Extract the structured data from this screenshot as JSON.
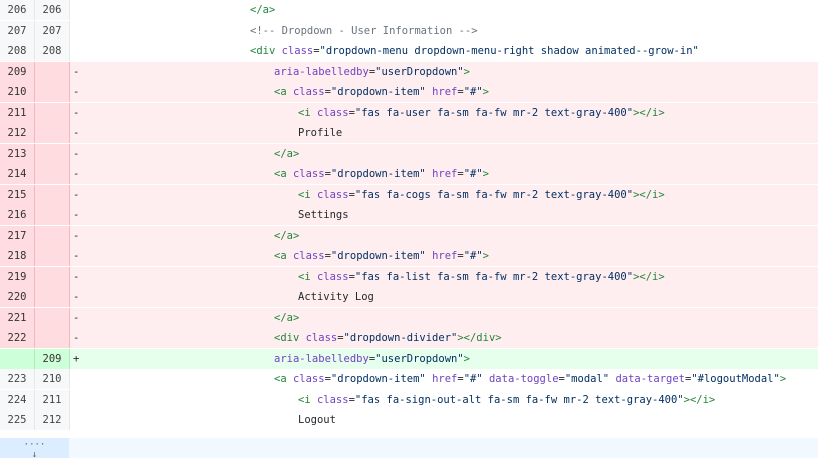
{
  "rows": [
    {
      "type": "ctx",
      "old": "206",
      "new": "206",
      "marker": "",
      "indent": 7,
      "tokens": [
        [
          "tag",
          "</a>"
        ]
      ]
    },
    {
      "type": "ctx",
      "old": "207",
      "new": "207",
      "marker": "",
      "indent": 7,
      "tokens": [
        [
          "cmt",
          "<!-- Dropdown - User Information -->"
        ]
      ]
    },
    {
      "type": "ctx",
      "old": "208",
      "new": "208",
      "marker": "",
      "indent": 7,
      "tokens": [
        [
          "tag",
          "<div "
        ],
        [
          "attr",
          "class"
        ],
        [
          "punc",
          "="
        ],
        [
          "str",
          "\"dropdown-menu dropdown-menu-right shadow animated--grow-in\""
        ]
      ]
    },
    {
      "type": "del",
      "old": "209",
      "new": "",
      "marker": "-",
      "indent": 8,
      "tokens": [
        [
          "attr",
          "aria-labelledby"
        ],
        [
          "punc",
          "="
        ],
        [
          "str",
          "\"userDropdown\""
        ],
        [
          "tag",
          ">"
        ]
      ]
    },
    {
      "type": "del",
      "old": "210",
      "new": "",
      "marker": "-",
      "indent": 8,
      "tokens": [
        [
          "tag",
          "<a "
        ],
        [
          "attr",
          "class"
        ],
        [
          "punc",
          "="
        ],
        [
          "str",
          "\"dropdown-item\""
        ],
        [
          "punc",
          " "
        ],
        [
          "attr",
          "href"
        ],
        [
          "punc",
          "="
        ],
        [
          "str",
          "\"#\""
        ],
        [
          "tag",
          ">"
        ]
      ]
    },
    {
      "type": "del",
      "old": "211",
      "new": "",
      "marker": "-",
      "indent": 9,
      "tokens": [
        [
          "tag",
          "<i "
        ],
        [
          "attr",
          "class"
        ],
        [
          "punc",
          "="
        ],
        [
          "str",
          "\"fas fa-user fa-sm fa-fw mr-2 text-gray-400\""
        ],
        [
          "tag",
          "></i>"
        ]
      ]
    },
    {
      "type": "del",
      "old": "212",
      "new": "",
      "marker": "-",
      "indent": 9,
      "tokens": [
        [
          "txt",
          "Profile"
        ]
      ]
    },
    {
      "type": "del",
      "old": "213",
      "new": "",
      "marker": "-",
      "indent": 8,
      "tokens": [
        [
          "tag",
          "</a>"
        ]
      ]
    },
    {
      "type": "del",
      "old": "214",
      "new": "",
      "marker": "-",
      "indent": 8,
      "tokens": [
        [
          "tag",
          "<a "
        ],
        [
          "attr",
          "class"
        ],
        [
          "punc",
          "="
        ],
        [
          "str",
          "\"dropdown-item\""
        ],
        [
          "punc",
          " "
        ],
        [
          "attr",
          "href"
        ],
        [
          "punc",
          "="
        ],
        [
          "str",
          "\"#\""
        ],
        [
          "tag",
          ">"
        ]
      ]
    },
    {
      "type": "del",
      "old": "215",
      "new": "",
      "marker": "-",
      "indent": 9,
      "tokens": [
        [
          "tag",
          "<i "
        ],
        [
          "attr",
          "class"
        ],
        [
          "punc",
          "="
        ],
        [
          "str",
          "\"fas fa-cogs fa-sm fa-fw mr-2 text-gray-400\""
        ],
        [
          "tag",
          "></i>"
        ]
      ]
    },
    {
      "type": "del",
      "old": "216",
      "new": "",
      "marker": "-",
      "indent": 9,
      "tokens": [
        [
          "txt",
          "Settings"
        ]
      ]
    },
    {
      "type": "del",
      "old": "217",
      "new": "",
      "marker": "-",
      "indent": 8,
      "tokens": [
        [
          "tag",
          "</a>"
        ]
      ]
    },
    {
      "type": "del",
      "old": "218",
      "new": "",
      "marker": "-",
      "indent": 8,
      "tokens": [
        [
          "tag",
          "<a "
        ],
        [
          "attr",
          "class"
        ],
        [
          "punc",
          "="
        ],
        [
          "str",
          "\"dropdown-item\""
        ],
        [
          "punc",
          " "
        ],
        [
          "attr",
          "href"
        ],
        [
          "punc",
          "="
        ],
        [
          "str",
          "\"#\""
        ],
        [
          "tag",
          ">"
        ]
      ]
    },
    {
      "type": "del",
      "old": "219",
      "new": "",
      "marker": "-",
      "indent": 9,
      "tokens": [
        [
          "tag",
          "<i "
        ],
        [
          "attr",
          "class"
        ],
        [
          "punc",
          "="
        ],
        [
          "str",
          "\"fas fa-list fa-sm fa-fw mr-2 text-gray-400\""
        ],
        [
          "tag",
          "></i>"
        ]
      ]
    },
    {
      "type": "del",
      "old": "220",
      "new": "",
      "marker": "-",
      "indent": 9,
      "tokens": [
        [
          "txt",
          "Activity Log"
        ]
      ]
    },
    {
      "type": "del",
      "old": "221",
      "new": "",
      "marker": "-",
      "indent": 8,
      "tokens": [
        [
          "tag",
          "</a>"
        ]
      ]
    },
    {
      "type": "del",
      "old": "222",
      "new": "",
      "marker": "-",
      "indent": 8,
      "tokens": [
        [
          "tag",
          "<div "
        ],
        [
          "attr",
          "class"
        ],
        [
          "punc",
          "="
        ],
        [
          "str",
          "\"dropdown-divider\""
        ],
        [
          "tag",
          "></div>"
        ]
      ]
    },
    {
      "type": "add",
      "old": "",
      "new": "209",
      "marker": "+",
      "indent": 8,
      "tokens": [
        [
          "attr",
          "aria-labelledby"
        ],
        [
          "punc",
          "="
        ],
        [
          "str",
          "\"userDropdown\""
        ],
        [
          "tag",
          ">"
        ]
      ]
    },
    {
      "type": "ctx",
      "old": "223",
      "new": "210",
      "marker": "",
      "indent": 8,
      "tokens": [
        [
          "tag",
          "<a "
        ],
        [
          "attr",
          "class"
        ],
        [
          "punc",
          "="
        ],
        [
          "str",
          "\"dropdown-item\""
        ],
        [
          "punc",
          " "
        ],
        [
          "attr",
          "href"
        ],
        [
          "punc",
          "="
        ],
        [
          "str",
          "\"#\""
        ],
        [
          "punc",
          " "
        ],
        [
          "attr",
          "data-toggle"
        ],
        [
          "punc",
          "="
        ],
        [
          "str",
          "\"modal\""
        ],
        [
          "punc",
          " "
        ],
        [
          "attr",
          "data-target"
        ],
        [
          "punc",
          "="
        ],
        [
          "str",
          "\"#logoutModal\""
        ],
        [
          "tag",
          ">"
        ]
      ]
    },
    {
      "type": "ctx",
      "old": "224",
      "new": "211",
      "marker": "",
      "indent": 9,
      "tokens": [
        [
          "tag",
          "<i "
        ],
        [
          "attr",
          "class"
        ],
        [
          "punc",
          "="
        ],
        [
          "str",
          "\"fas fa-sign-out-alt fa-sm fa-fw mr-2 text-gray-400\""
        ],
        [
          "tag",
          "></i>"
        ]
      ]
    },
    {
      "type": "ctx",
      "old": "225",
      "new": "212",
      "marker": "",
      "indent": 9,
      "tokens": [
        [
          "txt",
          "Logout"
        ]
      ]
    }
  ],
  "expand": {
    "icon": "expand-down-icon",
    "glyph": "⋯\n↓"
  }
}
